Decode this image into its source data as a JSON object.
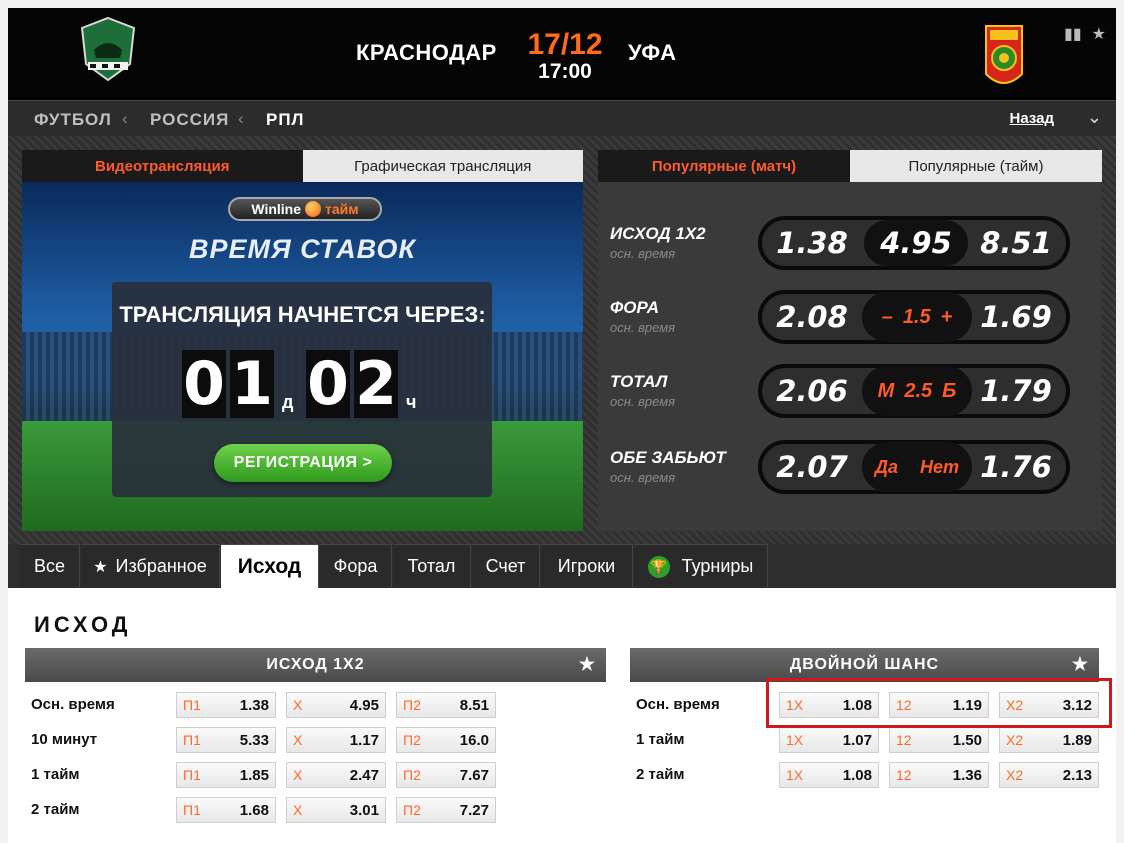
{
  "match": {
    "home": "КРАСНОДАР",
    "away": "УФА",
    "date": "17/12",
    "time": "17:00"
  },
  "breadcrumb": {
    "sport": "ФУТБОЛ",
    "country": "РОССИЯ",
    "league": "РПЛ",
    "back": "Назад"
  },
  "video": {
    "tab_video": "Видеотрансляция",
    "tab_graphic": "Графическая трансляция",
    "brand": "Winline",
    "brand_suffix": "тайм",
    "heading": "ВРЕМЯ СТАВОК",
    "starts_in": "ТРАНСЛЯЦИЯ НАЧНЕТСЯ ЧЕРЕЗ:",
    "countdown": {
      "d1": "0",
      "d2": "1",
      "day_unit": "д",
      "h1": "0",
      "h2": "2",
      "hour_unit": "ч"
    },
    "register": "РЕГИСТРАЦИЯ >"
  },
  "popular": {
    "tab_match": "Популярные (матч)",
    "tab_half": "Популярные (тайм)",
    "rows": [
      {
        "label": "ИСХОД 1Х2",
        "sub": "осн. время",
        "v1": "1.38",
        "mid": "4.95",
        "v3": "8.51"
      },
      {
        "label": "ФОРА",
        "sub": "осн. время",
        "v1": "2.08",
        "mid_a": "–",
        "mid_b": "1.5",
        "mid_c": "+",
        "v3": "1.69"
      },
      {
        "label": "ТОТАЛ",
        "sub": "осн. время",
        "v1": "2.06",
        "mid_a": "М",
        "mid_b": "2.5",
        "mid_c": "Б",
        "v3": "1.79"
      },
      {
        "label": "ОБЕ ЗАБЬЮТ",
        "sub": "осн. время",
        "v1": "2.07",
        "mid_a": "Да",
        "mid_b": "",
        "mid_c": "Нет",
        "v3": "1.76"
      }
    ]
  },
  "market_tabs": [
    "Все",
    "Избранное",
    "Исход",
    "Фора",
    "Тотал",
    "Счет",
    "Игроки",
    "Турниры"
  ],
  "section_title": "ИСХОД",
  "outcome": {
    "title": "ИСХОД 1Х2",
    "rows": [
      {
        "label": "Осн. время",
        "p1": "1.38",
        "x": "4.95",
        "p2": "8.51"
      },
      {
        "label": "10 минут",
        "p1": "5.33",
        "x": "1.17",
        "p2": "16.0"
      },
      {
        "label": "1 тайм",
        "p1": "1.85",
        "x": "2.47",
        "p2": "7.67"
      },
      {
        "label": "2 тайм",
        "p1": "1.68",
        "x": "3.01",
        "p2": "7.27"
      }
    ],
    "keys": {
      "p1": "П1",
      "x": "Х",
      "p2": "П2"
    }
  },
  "double_chance": {
    "title": "ДВОЙНОЙ ШАНС",
    "rows": [
      {
        "label": "Осн. время",
        "k1x": "1.08",
        "k12": "1.19",
        "kx2": "3.12"
      },
      {
        "label": "1 тайм",
        "k1x": "1.07",
        "k12": "1.50",
        "kx2": "1.89"
      },
      {
        "label": "2 тайм",
        "k1x": "1.08",
        "k12": "1.36",
        "kx2": "2.13"
      }
    ],
    "keys": {
      "k1x": "1Х",
      "k12": "12",
      "kx2": "Х2"
    }
  },
  "colors": {
    "accent": "#ff6a1a",
    "highlight": "#d01818",
    "green": "#2f9a1e"
  }
}
